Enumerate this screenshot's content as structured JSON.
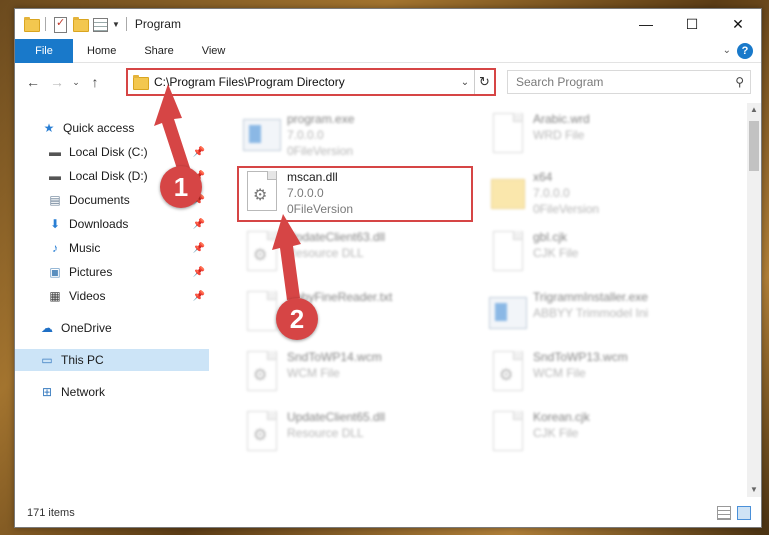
{
  "window": {
    "title": "Program"
  },
  "ribbon": {
    "tabs": [
      "File",
      "Home",
      "Share",
      "View"
    ]
  },
  "address": {
    "path": "C:\\Program Files\\Program Directory"
  },
  "search": {
    "placeholder": "Search Program"
  },
  "sidebar": {
    "items": [
      {
        "label": "Quick access",
        "icon": "star-icon"
      },
      {
        "label": "Local Disk (C:)",
        "icon": "drive-icon",
        "pinned": true
      },
      {
        "label": "Local Disk (D:)",
        "icon": "drive-icon",
        "pinned": true
      },
      {
        "label": "Documents",
        "icon": "documents-icon",
        "pinned": true
      },
      {
        "label": "Downloads",
        "icon": "download-icon",
        "pinned": true
      },
      {
        "label": "Music",
        "icon": "music-icon",
        "pinned": true
      },
      {
        "label": "Pictures",
        "icon": "pictures-icon",
        "pinned": true
      },
      {
        "label": "Videos",
        "icon": "videos-icon",
        "pinned": true
      },
      {
        "label": "OneDrive",
        "icon": "cloud-icon"
      },
      {
        "label": "This PC",
        "icon": "computer-icon",
        "selected": true
      },
      {
        "label": "Network",
        "icon": "network-icon"
      }
    ]
  },
  "files": {
    "highlighted": {
      "name": "mscan.dll",
      "version": "7.0.0.0",
      "description": "0FileVersion"
    },
    "blurred": [
      {
        "name": "program.exe",
        "line2": "7.0.0.0",
        "line3": "0FileVersion"
      },
      {
        "name": "Arabic.wrd",
        "line2": "WRD File",
        "line3": ""
      },
      {
        "name": "x64",
        "line2": "7.0.0.0",
        "line3": "0FileVersion"
      },
      {
        "name": "UpdateClient63.dll",
        "line2": "Resource DLL",
        "line3": ""
      },
      {
        "name": "gbl.cjk",
        "line2": "CJK File",
        "line3": ""
      },
      {
        "name": "AbbyFineReader.txt",
        "line2": "File",
        "line3": ""
      },
      {
        "name": "TrigrammInstaller.exe",
        "line2": "ABBYY Trimmodel Ini",
        "line3": ""
      },
      {
        "name": "SndToWP14.wcm",
        "line2": "WCM File",
        "line3": ""
      },
      {
        "name": "SndToWP13.wcm",
        "line2": "WCM File",
        "line3": ""
      },
      {
        "name": "UpdateClient65.dll",
        "line2": "Resource DLL",
        "line3": ""
      },
      {
        "name": "Korean.cjk",
        "line2": "CJK File",
        "line3": ""
      }
    ]
  },
  "status": {
    "item_count": "171 items"
  },
  "annotations": {
    "step1": "1",
    "step2": "2"
  },
  "colors": {
    "accent": "#1979ca",
    "annotation": "#d64545",
    "selected": "#cce4f7"
  }
}
